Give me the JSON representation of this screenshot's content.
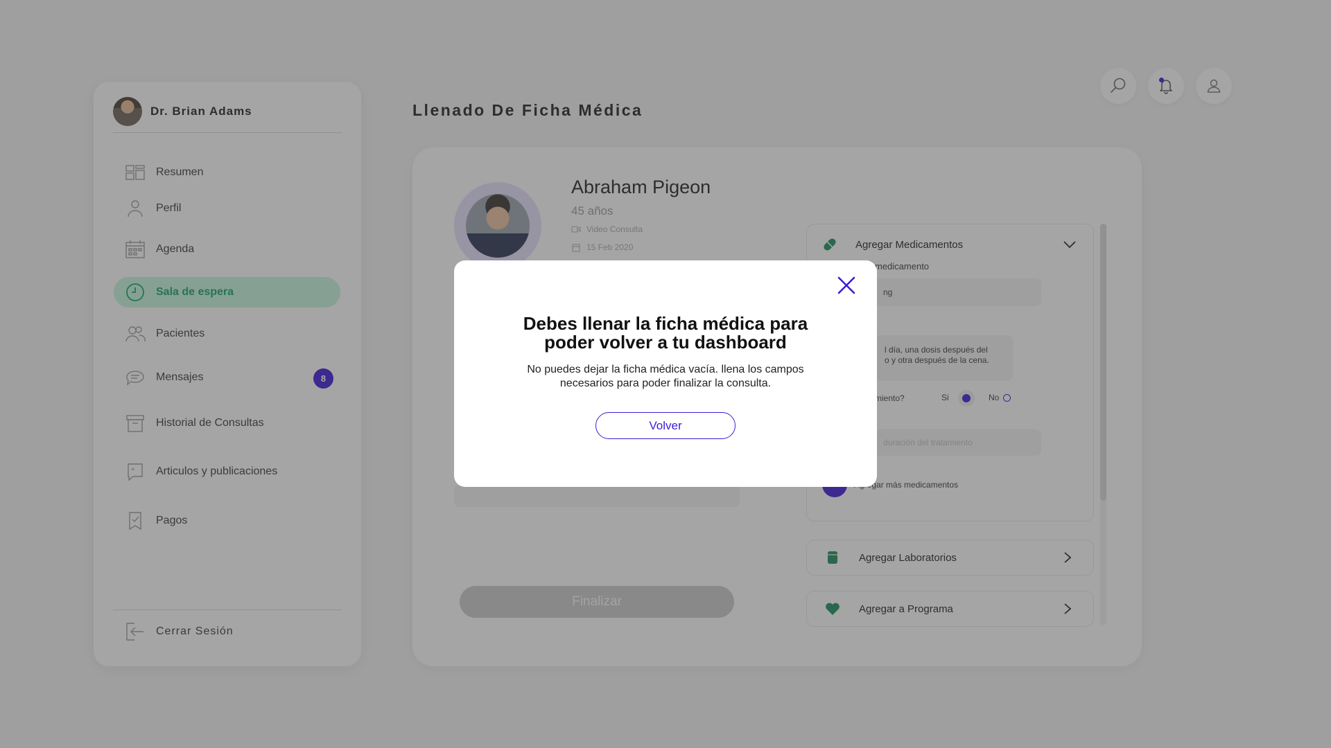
{
  "doctor": {
    "name": "Dr. Brian Adams"
  },
  "nav": {
    "items": [
      {
        "label": "Resumen",
        "icon": "dashboard-icon"
      },
      {
        "label": "Perfil",
        "icon": "user-icon"
      },
      {
        "label": "Agenda",
        "icon": "calendar-icon"
      },
      {
        "label": "Sala de espera",
        "icon": "clock-icon",
        "active": true
      },
      {
        "label": "Pacientes",
        "icon": "users-icon"
      },
      {
        "label": "Mensajes",
        "icon": "chat-icon",
        "badge": "8"
      },
      {
        "label": "Historial de Consultas",
        "icon": "archive-icon"
      },
      {
        "label": "Articulos y publicaciones",
        "icon": "article-icon"
      },
      {
        "label": "Pagos",
        "icon": "receipt-icon"
      }
    ],
    "logout": "Cerrar Sesión"
  },
  "page": {
    "title": "Llenado De Ficha Médica"
  },
  "patient": {
    "name": "Abraham Pigeon",
    "age": "45 años",
    "consult_type": "Video Consulta",
    "date": "15 Feb 2020"
  },
  "medications": {
    "header": "Agregar Medicamentos",
    "name_label": "medicamento",
    "name_value": "ng",
    "dosage_line1": "l día, una dosis después del",
    "dosage_line2": "o y otra después de la cena.",
    "treatment_question": "miento?",
    "yes_label": "Si",
    "no_label": "No",
    "duration_placeholder": "duración del tratamiento",
    "add_more": "Agregar más medicamentos"
  },
  "labs": {
    "label": "Agregar Laboratorios"
  },
  "program": {
    "label": "Agregar a Programa"
  },
  "finalize_label": "Finalizar",
  "modal": {
    "title_line1": "Debes llenar la ficha médica para",
    "title_line2": "poder volver a tu dashboard",
    "text_line1": "No puedes dejar la ficha médica vacía. llena los campos",
    "text_line2": "necesarios para poder finalizar la consulta.",
    "button": "Volver"
  },
  "colors": {
    "accent": "#3e1ad6",
    "active_bg": "#c5f2dc",
    "active_text": "#12a36a",
    "green_icon": "#1b8d5a"
  }
}
